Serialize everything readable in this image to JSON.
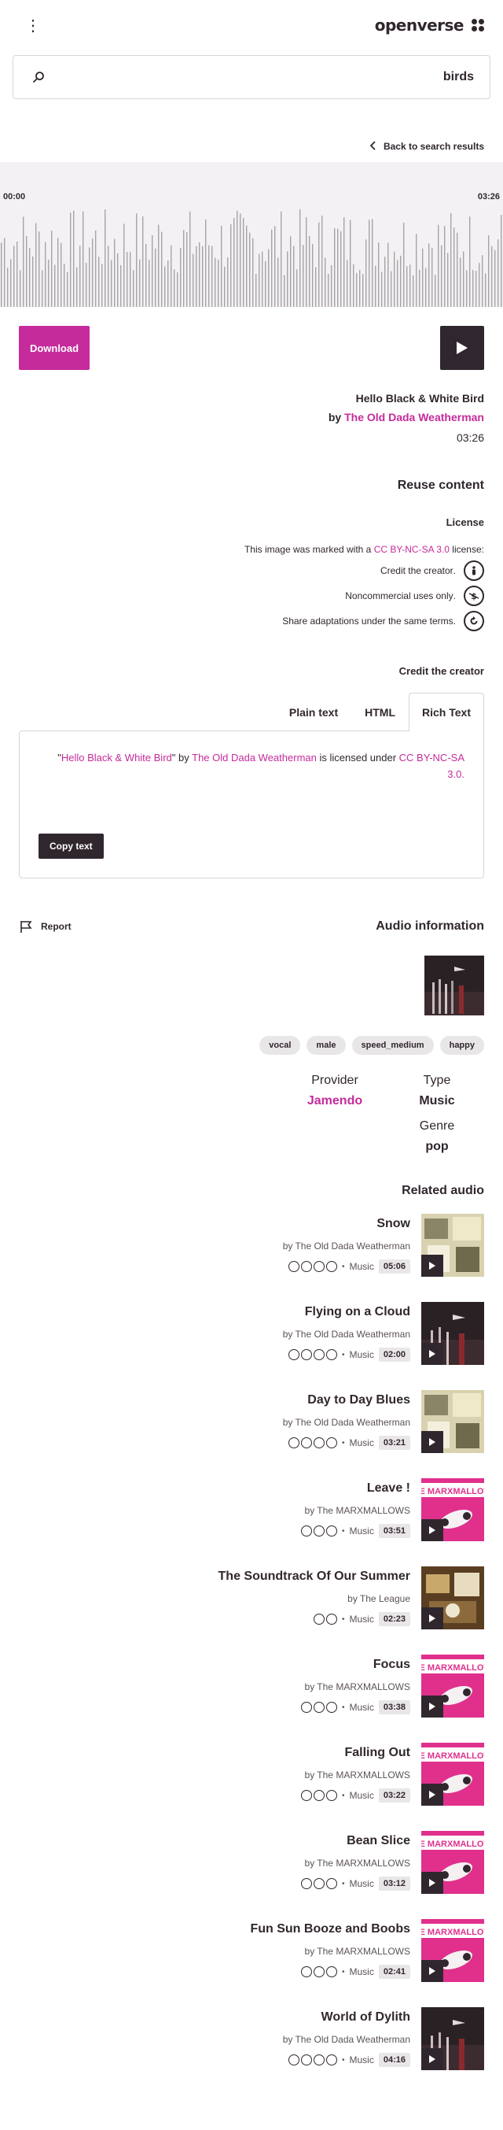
{
  "header": {
    "logo_text": "openverse",
    "menu_icon": "dots-vertical-icon",
    "logo_icon": "openverse-logo-icon"
  },
  "search": {
    "value": "birds",
    "search_icon": "search-icon"
  },
  "back_link": {
    "label": "Back to search results"
  },
  "player": {
    "start_time": "00:00",
    "end_time": "03:26",
    "download_label": "Download"
  },
  "track": {
    "title": "Hello Black & White Bird",
    "by": "by",
    "creator": "The Old Dada Weatherman",
    "duration": "03:26"
  },
  "reuse": {
    "title": "Reuse content",
    "license_heading": "License",
    "license_prefix": ":This image was marked with a",
    "license_name": "CC BY-NC-SA 3.0",
    "license_suffix": "license",
    "terms": [
      {
        "icon": "cc-by-icon",
        "text": ".Credit the creator"
      },
      {
        "icon": "cc-nc-icon",
        "text": ".Noncommercial uses only"
      },
      {
        "icon": "cc-sa-icon",
        "text": ".Share adaptations under the same terms"
      }
    ]
  },
  "credit": {
    "title": "Credit the creator",
    "tabs": [
      "Plain text",
      "HTML",
      "Rich Text"
    ],
    "active_tab": "Rich Text",
    "text_title": "Hello Black & White Bird",
    "text_by": "\" by",
    "text_creator": "The Old Dada Weatherman",
    "text_licensed": "is licensed under",
    "text_license": "CC BY-NC-SA",
    "text_line2": ".3.0",
    "copy_label": "Copy text"
  },
  "info": {
    "report_label": "Report",
    "title": "Audio information",
    "tags": [
      "happy",
      "speed_medium",
      "male",
      "vocal"
    ],
    "type_label": "Type",
    "type_value": "Music",
    "provider_label": "Provider",
    "provider_value": "Jamendo",
    "genre_label": "Genre",
    "genre_value": "pop"
  },
  "related": {
    "title": "Related audio",
    "items": [
      {
        "title": "Snow",
        "by": "by The Old Dada Weatherman",
        "category": "Music",
        "duration": "05:06",
        "cover": "collage"
      },
      {
        "title": "Flying on a Cloud",
        "by": "by The Old Dada Weatherman",
        "category": "Music",
        "duration": "02:00",
        "cover": "dark"
      },
      {
        "title": "Day to Day Blues",
        "by": "by The Old Dada Weatherman",
        "category": "Music",
        "duration": "03:21",
        "cover": "collage"
      },
      {
        "title": "! Leave",
        "by": "by The MARXMALLOWS",
        "category": "Music",
        "duration": "03:51",
        "cover": "pink"
      },
      {
        "title": "The Soundtrack Of Our Summer",
        "by": "by The League",
        "category": "Music",
        "duration": "02:23",
        "cover": "brown"
      },
      {
        "title": "Focus",
        "by": "by The MARXMALLOWS",
        "category": "Music",
        "duration": "03:38",
        "cover": "pink"
      },
      {
        "title": "Falling Out",
        "by": "by The MARXMALLOWS",
        "category": "Music",
        "duration": "03:22",
        "cover": "pink"
      },
      {
        "title": "Bean Slice",
        "by": "by The MARXMALLOWS",
        "category": "Music",
        "duration": "03:12",
        "cover": "pink"
      },
      {
        "title": "Fun Sun Booze and Boobs",
        "by": "by The MARXMALLOWS",
        "category": "Music",
        "duration": "02:41",
        "cover": "pink"
      },
      {
        "title": "World of Dylith",
        "by": "by The Old Dada Weatherman",
        "category": "Music",
        "duration": "04:16",
        "cover": "dark"
      }
    ]
  },
  "colors": {
    "accent": "#c52b9b",
    "dark": "#30272e",
    "wave_bg": "#f3f1f3"
  }
}
